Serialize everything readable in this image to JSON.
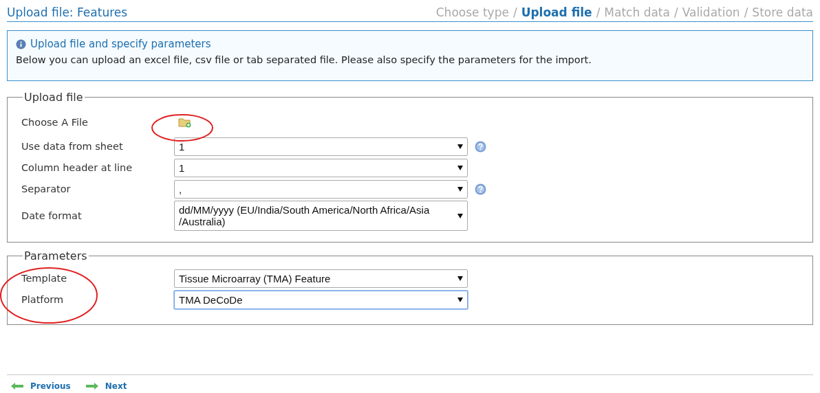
{
  "header": {
    "title": "Upload file: Features",
    "steps": [
      {
        "label": "Choose type",
        "selected": false
      },
      {
        "label": "Upload file",
        "selected": true
      },
      {
        "label": "Match data",
        "selected": false
      },
      {
        "label": "Validation",
        "selected": false
      },
      {
        "label": "Store data",
        "selected": false
      }
    ],
    "separator": "/"
  },
  "info": {
    "title": "Upload file and specify parameters",
    "text": "Below you can upload an excel file, csv file or tab separated file. Please also specify the parameters for the import."
  },
  "upload_section": {
    "legend": "Upload file",
    "rows": [
      {
        "kind": "file",
        "label": "Choose A File"
      },
      {
        "kind": "select",
        "label": "Use data from sheet",
        "value": "1",
        "help": true,
        "focused": false
      },
      {
        "kind": "select",
        "label": "Column header at line",
        "value": "1",
        "help": false,
        "focused": false
      },
      {
        "kind": "select",
        "label": "Separator",
        "value": ",",
        "help": true,
        "focused": false
      },
      {
        "kind": "select",
        "label": "Date format",
        "value": "dd/MM/yyyy (EU/India/South America/North Africa/Asia /Australia)",
        "help": false,
        "focused": false
      }
    ]
  },
  "parameters_section": {
    "legend": "Parameters",
    "rows": [
      {
        "kind": "select",
        "label": "Template",
        "value": "Tissue Microarray (TMA) Feature",
        "help": false,
        "focused": false
      },
      {
        "kind": "select",
        "label": "Platform",
        "value": "TMA DeCoDe",
        "help": false,
        "focused": true
      }
    ]
  },
  "footer": {
    "previous": "Previous",
    "next": "Next"
  }
}
